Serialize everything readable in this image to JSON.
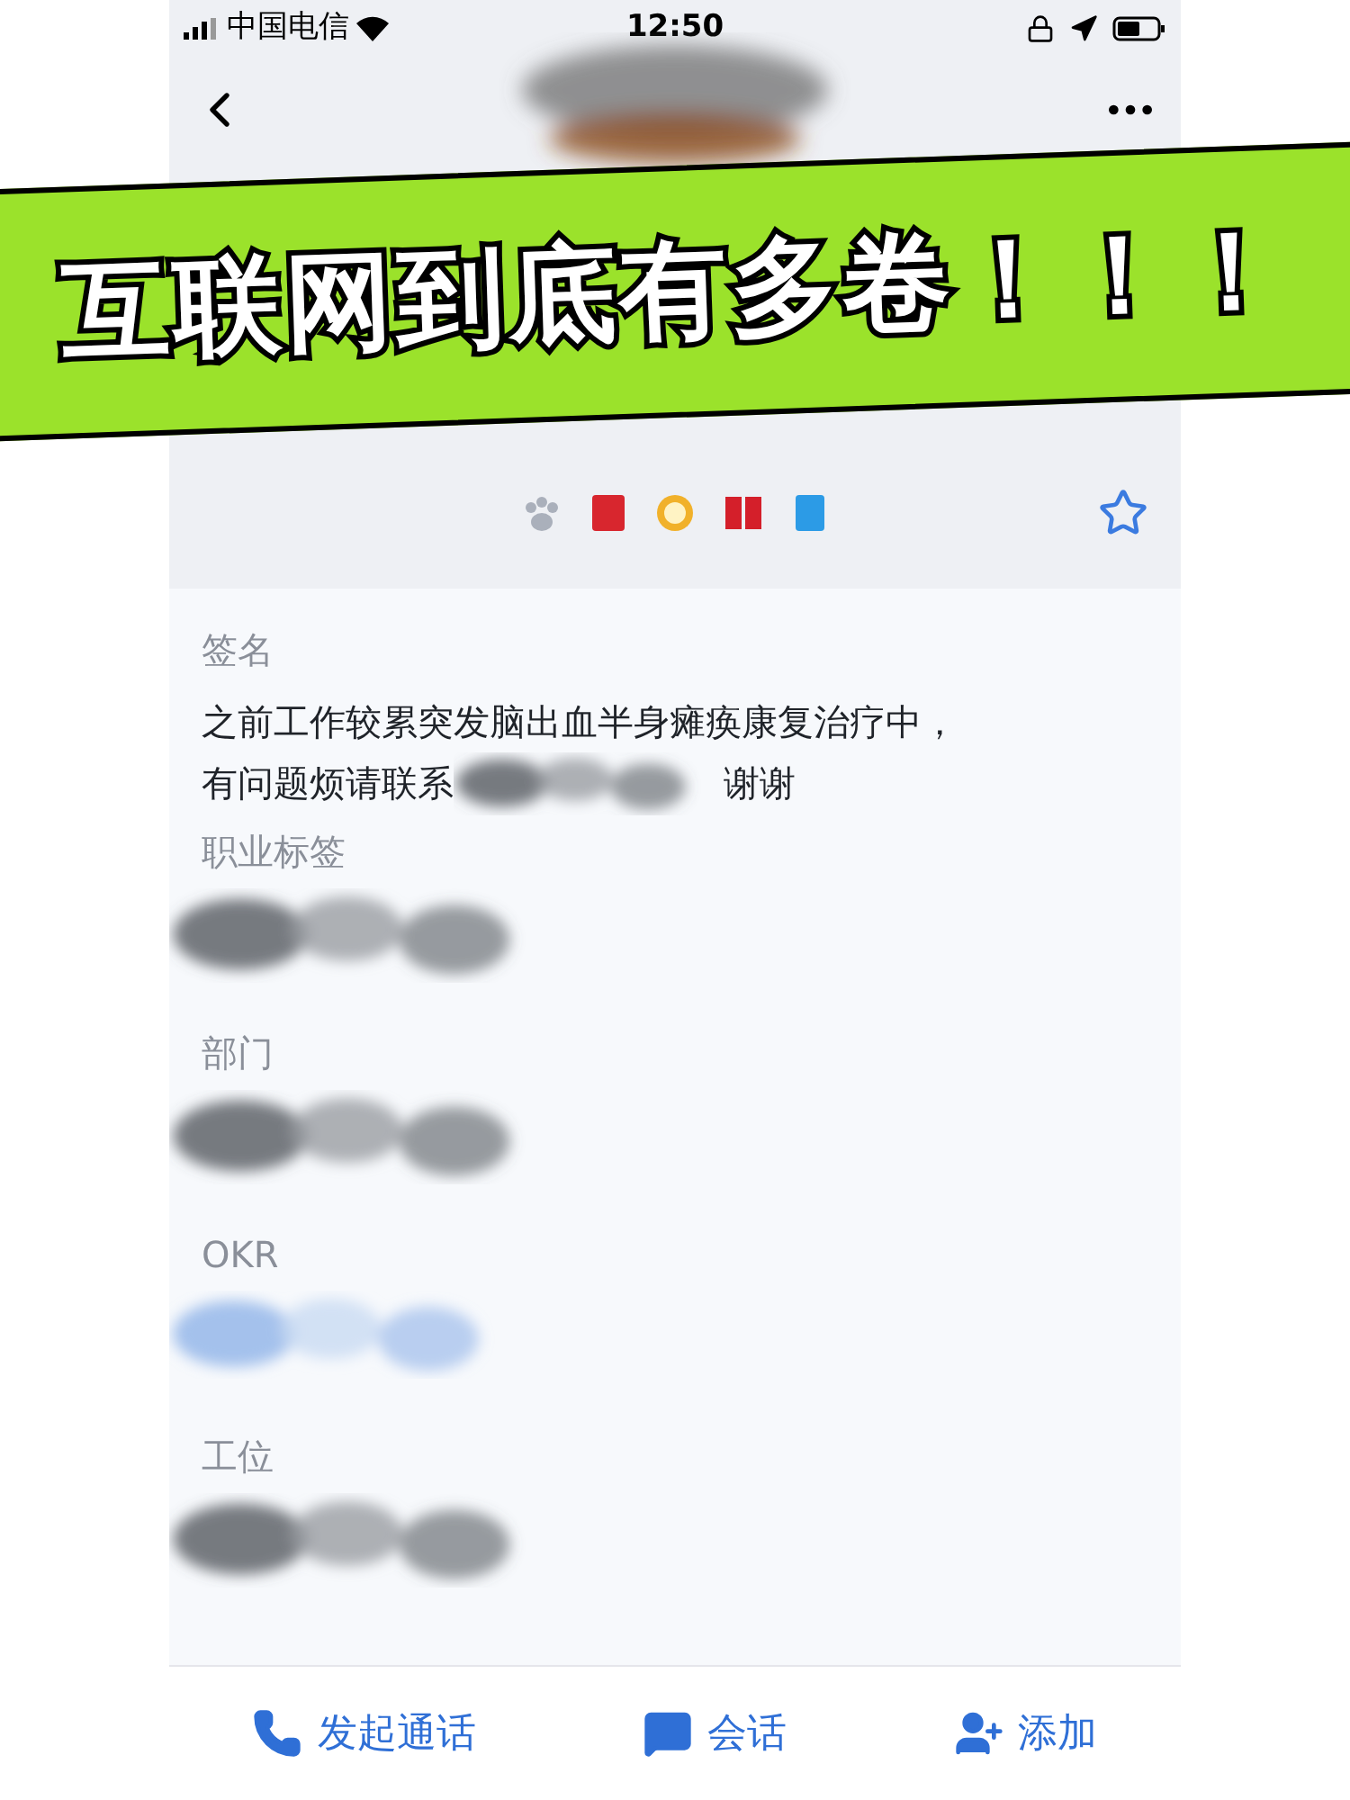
{
  "status_bar": {
    "carrier": "中国电信",
    "time": "12:50"
  },
  "banner": {
    "text": "互联网到底有多卷！！！"
  },
  "sections": [
    {
      "label": "签名",
      "kind": "text",
      "lines": [
        "之前工作较累突发脑出血半身瘫痪康复治疗中，",
        "有问题烦请联系"
      ],
      "tail": "谢谢"
    },
    {
      "label": "职业标签",
      "kind": "redacted"
    },
    {
      "label": "部门",
      "kind": "redacted"
    },
    {
      "label": "OKR",
      "kind": "redacted-blue"
    },
    {
      "label": "工位",
      "kind": "redacted"
    }
  ],
  "actions": [
    {
      "label": "发起通话",
      "kind": "call"
    },
    {
      "label": "会话",
      "kind": "chat"
    },
    {
      "label": "添加",
      "kind": "add"
    }
  ]
}
